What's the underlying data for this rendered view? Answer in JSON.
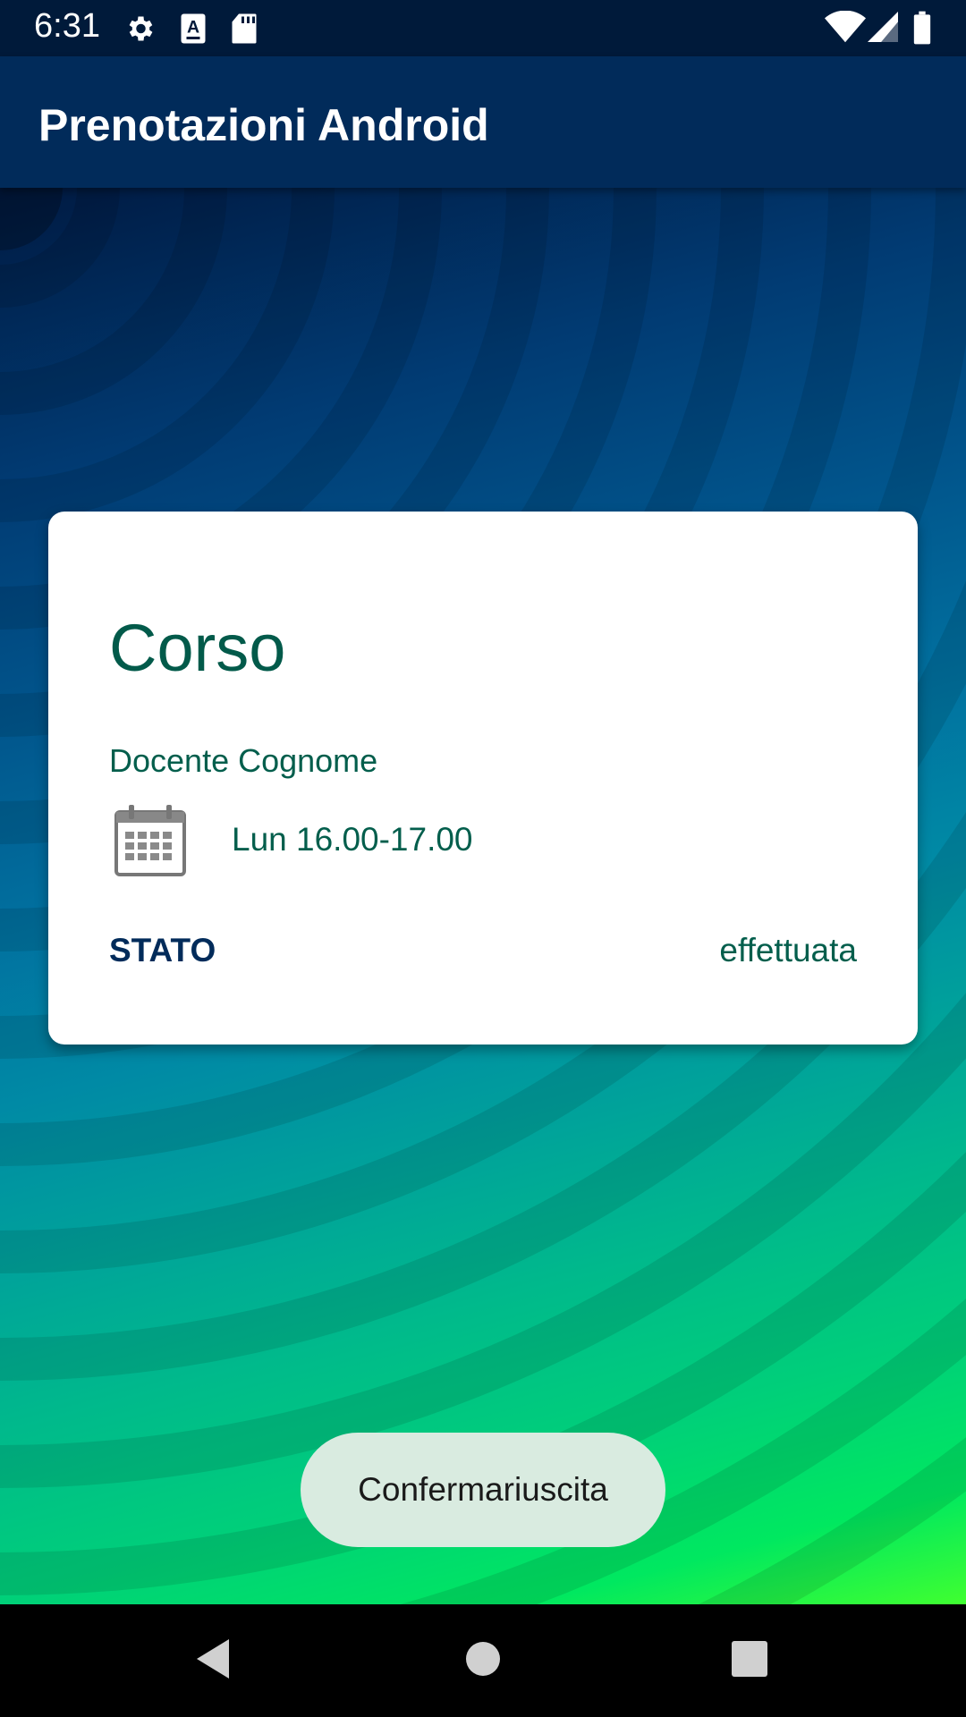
{
  "status_bar": {
    "time": "6:31",
    "icons_left": [
      "gear-icon",
      "font-a-icon",
      "sd-card-icon"
    ],
    "icons_right": [
      "wifi-icon",
      "cell-signal-icon",
      "battery-icon"
    ]
  },
  "app_bar": {
    "title": "Prenotazioni Android"
  },
  "card": {
    "course": "Corso",
    "teacher": "Docente Cognome",
    "schedule_icon": "calendar-icon",
    "schedule": "Lun 16.00-17.00",
    "status_label": "STATO",
    "status_value": "effettuata"
  },
  "confirm_button": {
    "label": "Confermariuscita"
  },
  "nav_bar": {
    "items": [
      "back-icon",
      "home-icon",
      "recents-icon"
    ]
  },
  "colors": {
    "status_bar_bg": "#001a3a",
    "app_bar_bg": "#012b5a",
    "accent_text": "#025a4a",
    "stato_label": "#012b5a",
    "button_bg": "#d9ebe0"
  }
}
